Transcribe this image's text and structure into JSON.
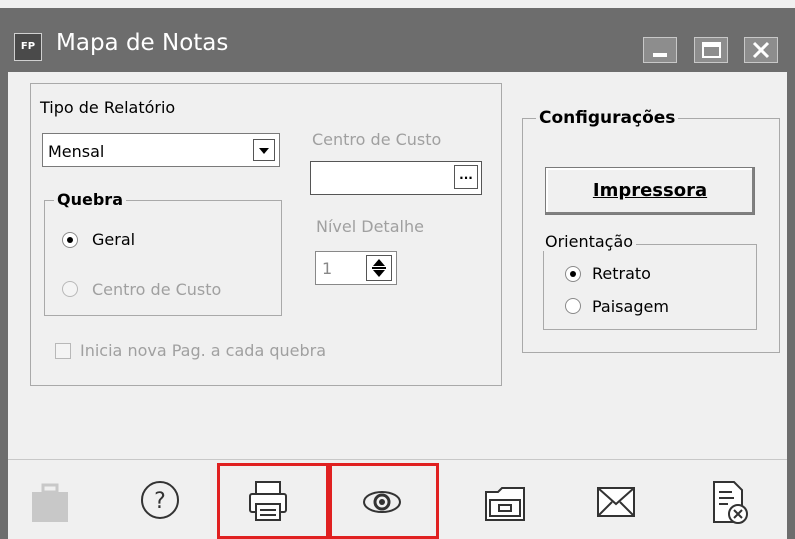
{
  "window": {
    "icon_text": "FP",
    "title": "Mapa de Notas"
  },
  "report_type": {
    "label": "Tipo de Relatório",
    "selected": "Mensal"
  },
  "quebra": {
    "title": "Quebra",
    "option_geral": "Geral",
    "option_centro": "Centro de Custo",
    "selected": "Geral"
  },
  "centro_custo": {
    "label": "Centro de Custo",
    "value": "",
    "browse_label": "..."
  },
  "nivel": {
    "label": "Nível Detalhe",
    "value": "1"
  },
  "checkbox_label": "Inicia nova Pag. a cada quebra",
  "config": {
    "title": "Configurações",
    "printer_button": "Impressora",
    "orientation_title": "Orientação",
    "option_retrato": "Retrato",
    "option_paisagem": "Paisagem",
    "selected": "Retrato"
  },
  "toolbar": {
    "icons": [
      "briefcase-icon",
      "help-icon",
      "printer-icon",
      "preview-eye-icon",
      "folder-icon",
      "mail-icon",
      "close-document-icon"
    ],
    "highlight_color": "#e02020"
  }
}
